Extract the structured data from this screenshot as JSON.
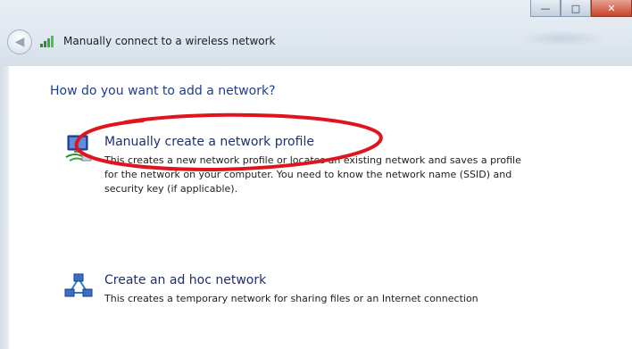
{
  "window": {
    "title": "Manually connect to a wireless network",
    "controls": {
      "minimize_glyph": "—",
      "maximize_glyph": "□",
      "close_glyph": "✕"
    }
  },
  "nav": {
    "back_glyph": "◀"
  },
  "page": {
    "heading": "How do you want to add a network?"
  },
  "options": [
    {
      "title": "Manually create a network profile",
      "desc_lines": [
        "This creates a new network profile or locates an existing network and saves a profile",
        "for the network on your computer. You need to know the network name (SSID) and",
        "security key (if applicable)."
      ],
      "icon": "network-profile-icon"
    },
    {
      "title": "Create an ad hoc network",
      "desc_lines": [
        "This creates a temporary network for sharing files or an Internet connection"
      ],
      "icon": "adhoc-network-icon"
    }
  ],
  "colors": {
    "heading": "#1f3d8f",
    "option_title": "#1f2f6e",
    "annotation_ellipse": "#e0141e"
  }
}
